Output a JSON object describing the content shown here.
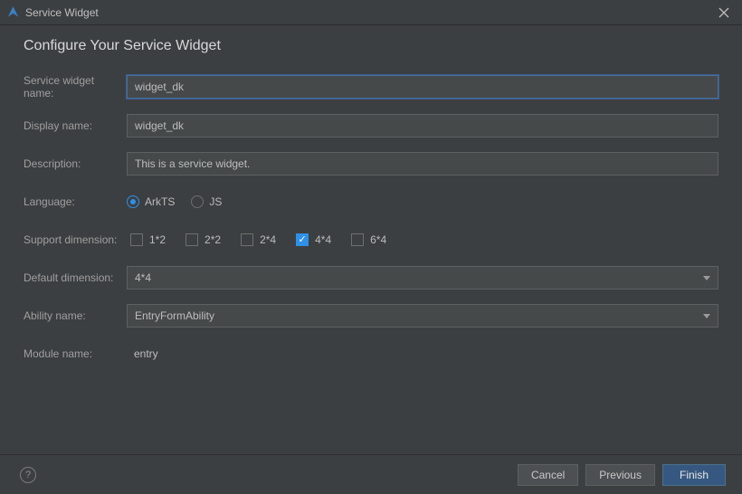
{
  "window": {
    "title": "Service Widget"
  },
  "heading": "Configure Your Service Widget",
  "labels": {
    "widget_name": "Service widget name:",
    "display_name": "Display name:",
    "description": "Description:",
    "language": "Language:",
    "support_dimension": "Support dimension:",
    "default_dimension": "Default dimension:",
    "ability_name": "Ability name:",
    "module_name": "Module name:"
  },
  "fields": {
    "widget_name_value": "widget_dk",
    "display_name_value": "widget_dk",
    "description_value": "This is a service widget.",
    "module_name_value": "entry"
  },
  "language": {
    "options": [
      {
        "label": "ArkTS",
        "selected": true
      },
      {
        "label": "JS",
        "selected": false
      }
    ]
  },
  "support_dimension": {
    "options": [
      {
        "label": "1*2",
        "checked": false
      },
      {
        "label": "2*2",
        "checked": false
      },
      {
        "label": "2*4",
        "checked": false
      },
      {
        "label": "4*4",
        "checked": true
      },
      {
        "label": "6*4",
        "checked": false
      }
    ]
  },
  "default_dimension": {
    "value": "4*4"
  },
  "ability_name": {
    "value": "EntryFormAbility"
  },
  "footer": {
    "cancel": "Cancel",
    "previous": "Previous",
    "finish": "Finish"
  }
}
